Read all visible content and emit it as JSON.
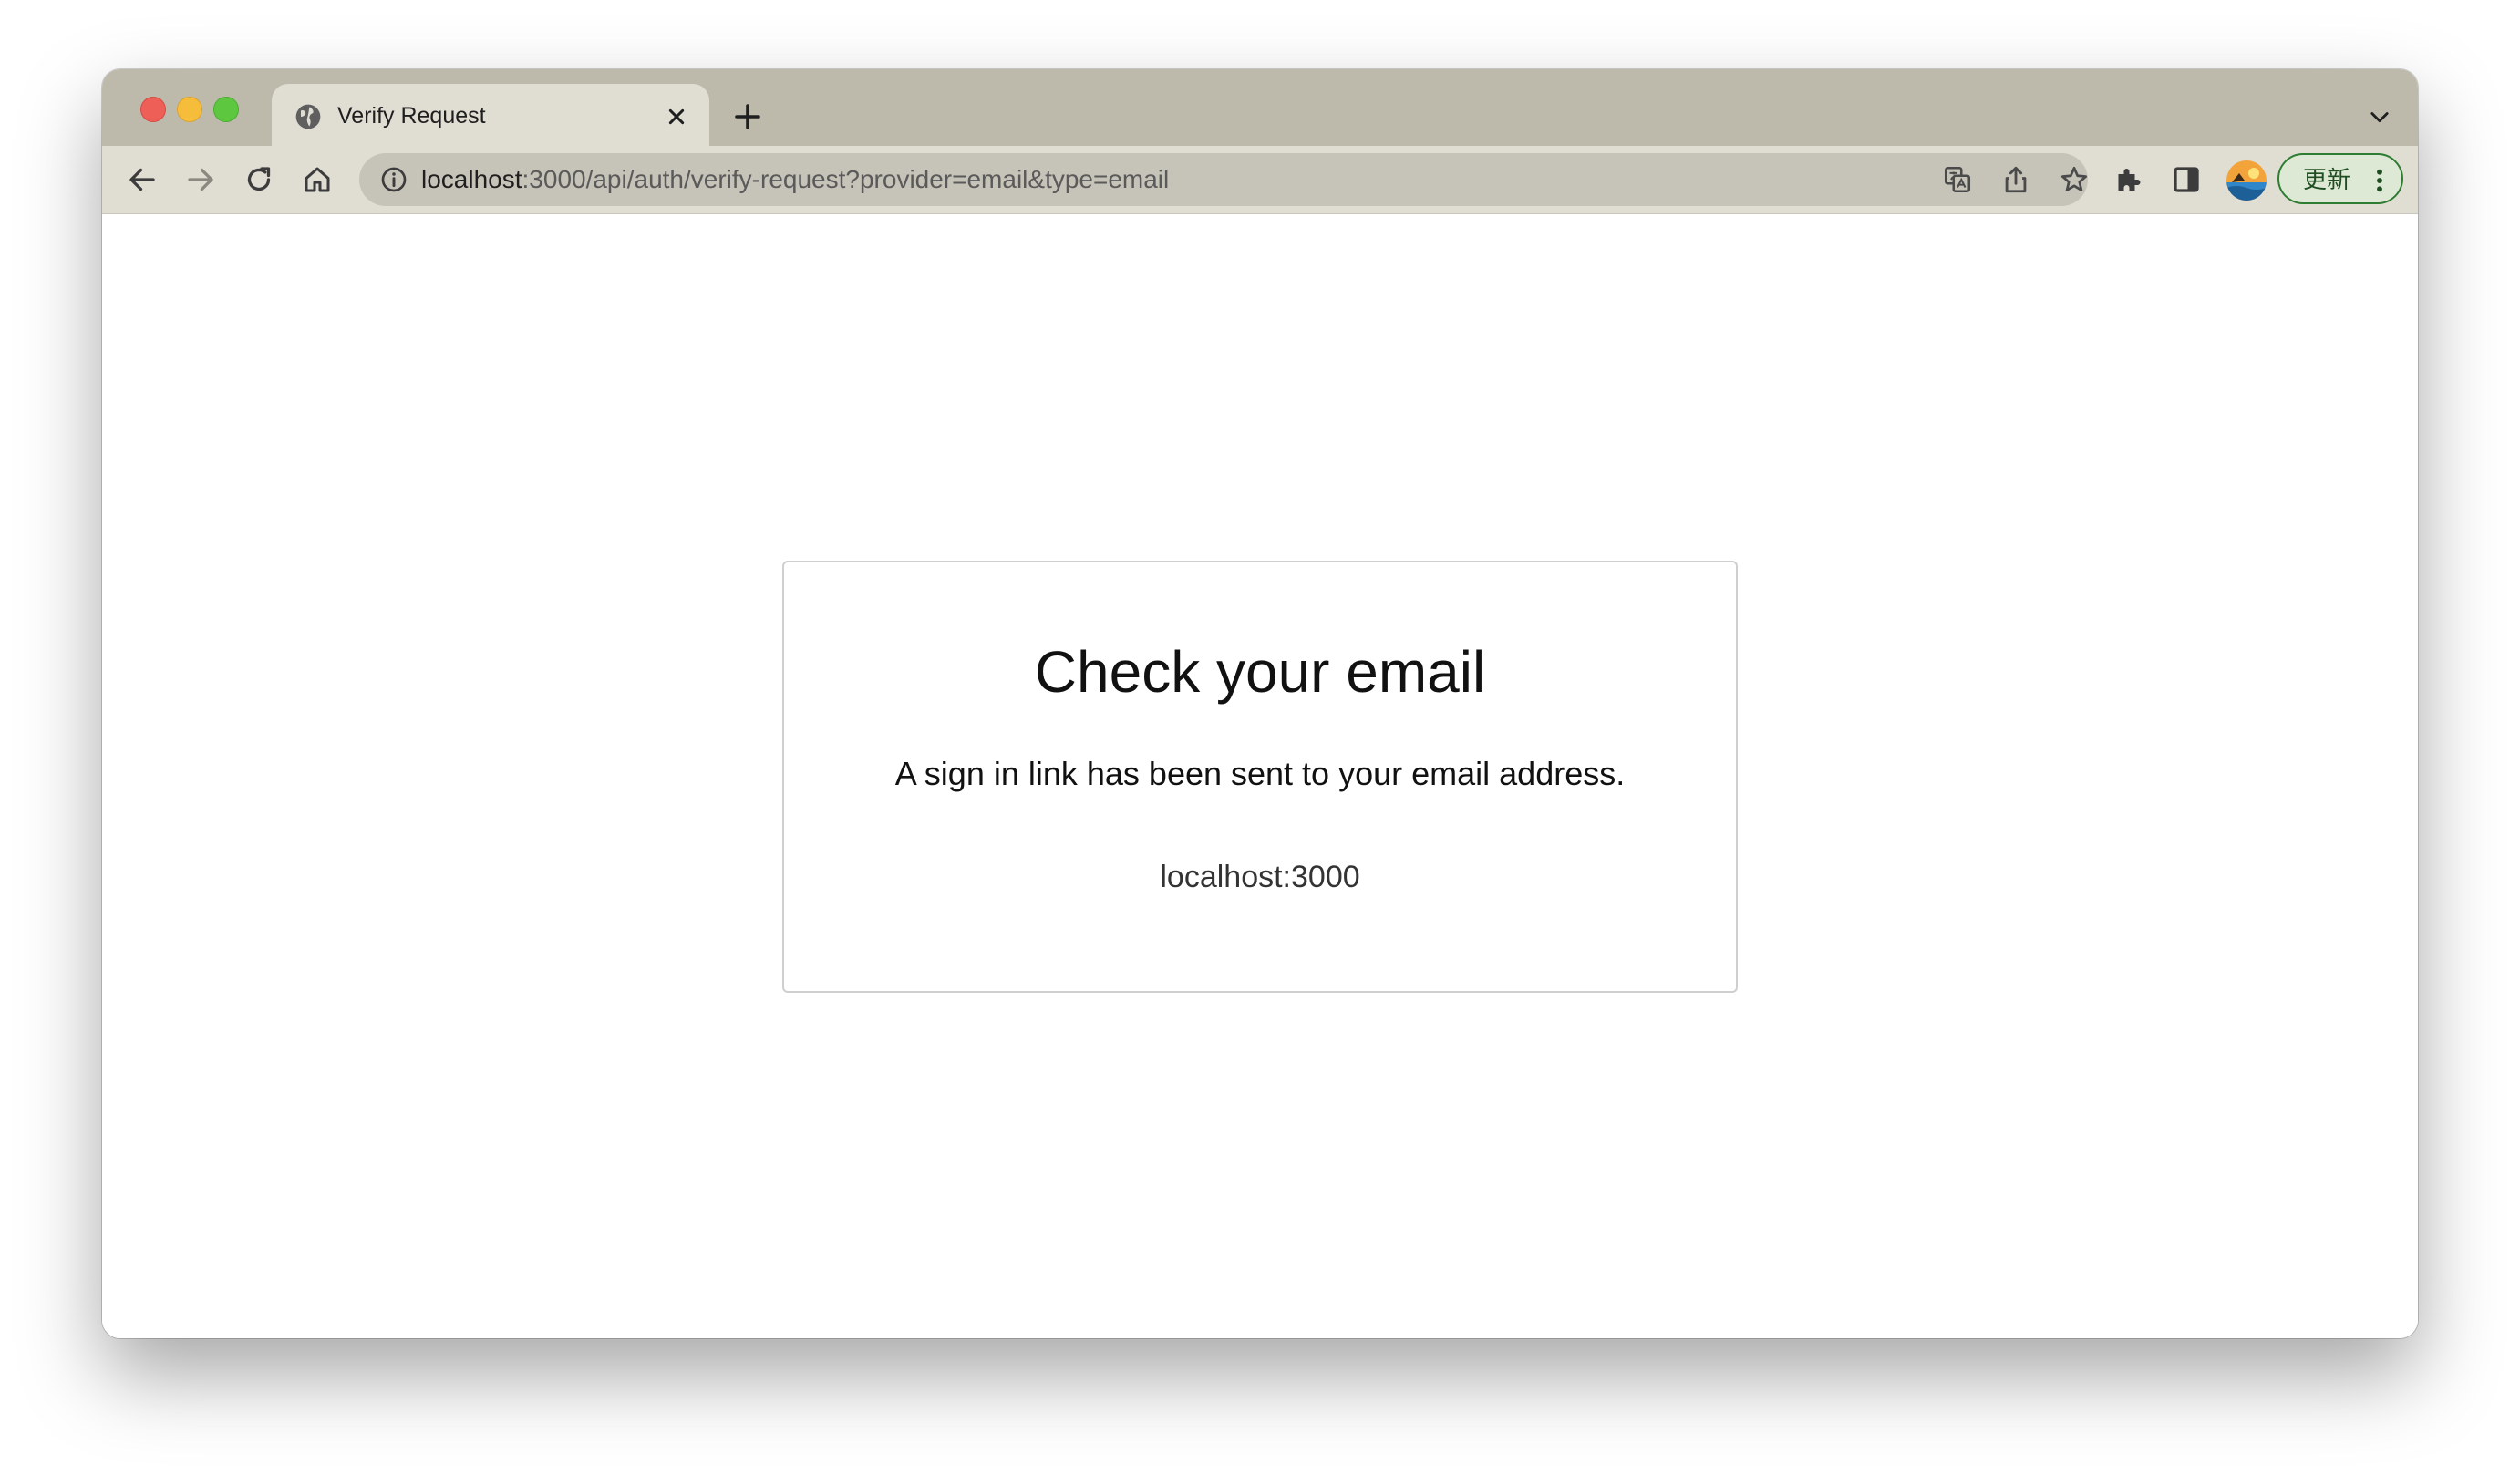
{
  "browser": {
    "tab": {
      "title": "Verify Request",
      "favicon": "globe-icon"
    },
    "address_bar": {
      "host": "localhost",
      "rest": ":3000/api/auth/verify-request?provider=email&type=email"
    },
    "update_button_label": "更新",
    "accent_color": "#2e7d32"
  },
  "page": {
    "title": "Check your email",
    "message": "A sign in link has been sent to your email address.",
    "site": "localhost:3000"
  }
}
